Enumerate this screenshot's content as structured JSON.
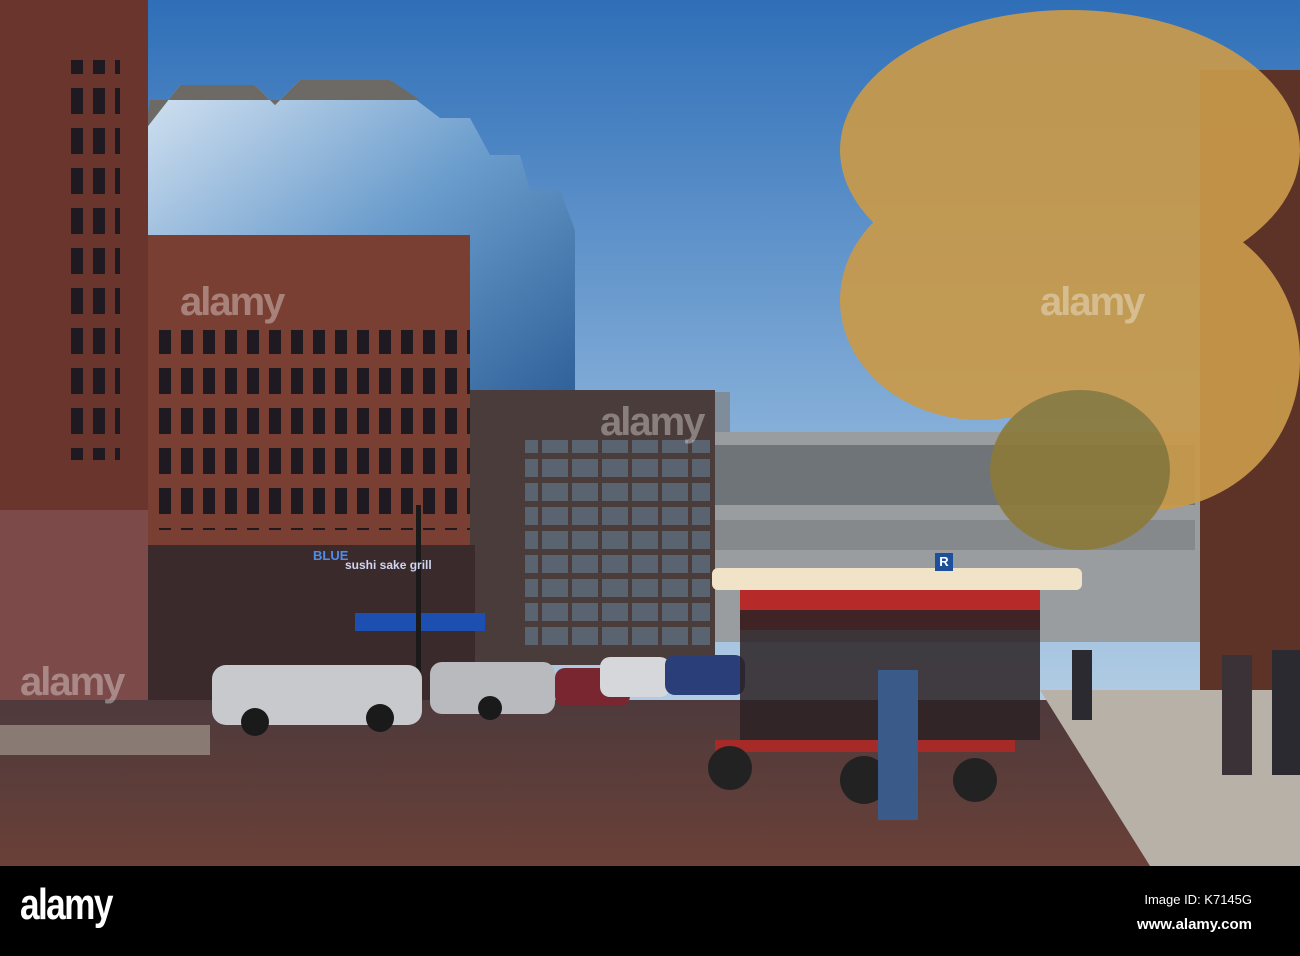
{
  "photo": {
    "storefront_brand": "BLUE",
    "storefront_subtitle": "sushi sake grill",
    "parking_sign": "R"
  },
  "watermark": {
    "text": "alamy"
  },
  "footer": {
    "logo": "alamy",
    "image_id": "Image ID: K7145G",
    "url": "www.alamy.com"
  },
  "colors": {
    "sky_top": "#2f6fb8",
    "sky_bottom": "#b9d2e6",
    "brick": "#7a3f33",
    "street": "#5a3b36",
    "awning": "#1d4fb0",
    "tree": "#c99a4a"
  }
}
